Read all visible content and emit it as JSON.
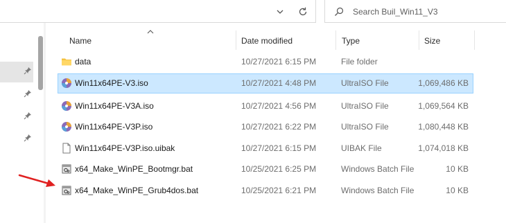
{
  "search": {
    "placeholder": "Search Buil_Win11_V3"
  },
  "columns": {
    "name": "Name",
    "date": "Date modified",
    "type": "Type",
    "size": "Size"
  },
  "files": [
    {
      "name": "data",
      "date": "10/27/2021 6:15 PM",
      "type": "File folder",
      "size": "",
      "icon": "folder-icon",
      "selected": false
    },
    {
      "name": "Win11x64PE-V3.iso",
      "date": "10/27/2021 4:48 PM",
      "type": "UltraISO File",
      "size": "1,069,486 KB",
      "icon": "iso-disc-icon",
      "selected": true
    },
    {
      "name": "Win11x64PE-V3A.iso",
      "date": "10/27/2021 4:56 PM",
      "type": "UltraISO File",
      "size": "1,069,564 KB",
      "icon": "iso-disc-icon",
      "selected": false
    },
    {
      "name": "Win11x64PE-V3P.iso",
      "date": "10/27/2021 6:22 PM",
      "type": "UltraISO File",
      "size": "1,080,448 KB",
      "icon": "iso-disc-icon",
      "selected": false
    },
    {
      "name": "Win11x64PE-V3P.iso.uibak",
      "date": "10/27/2021 6:15 PM",
      "type": "UIBAK File",
      "size": "1,074,018 KB",
      "icon": "blank-file-icon",
      "selected": false
    },
    {
      "name": "x64_Make_WinPE_Bootmgr.bat",
      "date": "10/25/2021 6:25 PM",
      "type": "Windows Batch File",
      "size": "10 KB",
      "icon": "batch-file-icon",
      "selected": false
    },
    {
      "name": "x64_Make_WinPE_Grub4dos.bat",
      "date": "10/25/2021 6:21 PM",
      "type": "Windows Batch File",
      "size": "10 KB",
      "icon": "batch-file-icon",
      "selected": false
    }
  ],
  "colors": {
    "selection": "#cce8ff",
    "selection_border": "#99d1ff",
    "arrow": "#e02020",
    "folder": "#f5c23f"
  }
}
